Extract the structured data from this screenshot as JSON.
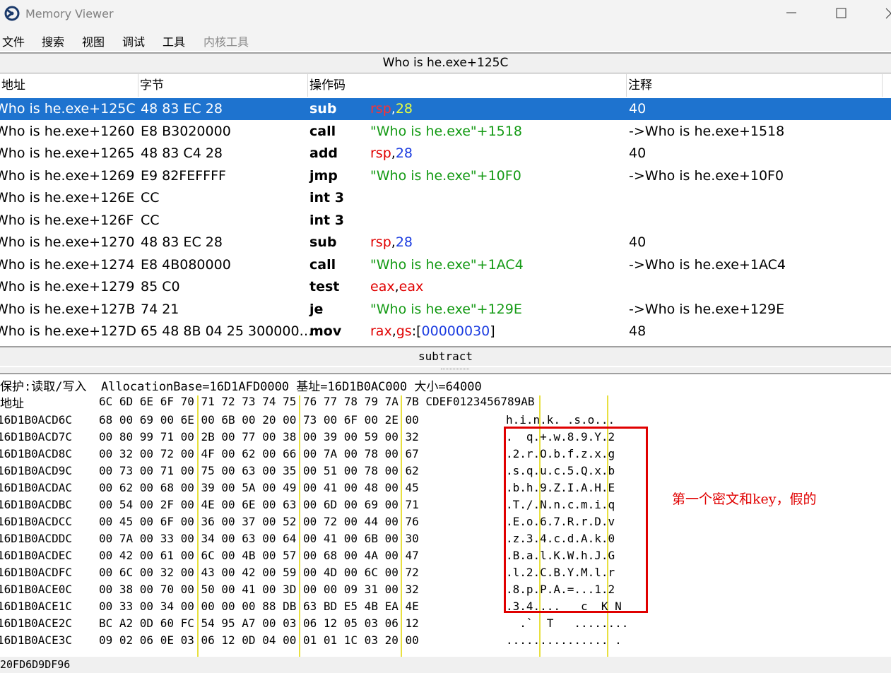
{
  "window": {
    "title": "Memory Viewer",
    "icons": {
      "app": "cheat-engine-icon",
      "minimize": "minimize-icon",
      "maximize": "maximize-icon",
      "close": "close-icon"
    }
  },
  "menu": [
    "文件",
    "搜索",
    "视图",
    "调试",
    "工具",
    "内核工具"
  ],
  "disasm": {
    "header": "Who is he.exe+125C",
    "columns": [
      "地址",
      "字节",
      "操作码",
      "注释"
    ],
    "rows": [
      {
        "addr": "Who is he.exe+125C",
        "bytes": "48 83 EC 28",
        "op": "sub",
        "args": [
          [
            "rsp",
            "red"
          ],
          [
            ",",
            ""
          ],
          [
            "28",
            "blue"
          ]
        ],
        "comment": "40",
        "selected": true
      },
      {
        "addr": "Who is he.exe+1260",
        "bytes": "E8 B3020000",
        "op": "call",
        "args": [
          [
            "\"Who is he.exe\"+1518",
            "green"
          ]
        ],
        "comment": "->Who is he.exe+1518"
      },
      {
        "addr": "Who is he.exe+1265",
        "bytes": "48 83 C4 28",
        "op": "add",
        "args": [
          [
            "rsp",
            "red"
          ],
          [
            ",",
            ""
          ],
          [
            "28",
            "blue"
          ]
        ],
        "comment": "40"
      },
      {
        "addr": "Who is he.exe+1269",
        "bytes": "E9 82FEFFFF",
        "op": "jmp",
        "args": [
          [
            "\"Who is he.exe\"+10F0",
            "green"
          ]
        ],
        "comment": "->Who is he.exe+10F0"
      },
      {
        "addr": "Who is he.exe+126E",
        "bytes": "CC",
        "op": "int 3",
        "args": [],
        "comment": ""
      },
      {
        "addr": "Who is he.exe+126F",
        "bytes": "CC",
        "op": "int 3",
        "args": [],
        "comment": ""
      },
      {
        "addr": "Who is he.exe+1270",
        "bytes": "48 83 EC 28",
        "op": "sub",
        "args": [
          [
            "rsp",
            "red"
          ],
          [
            ",",
            ""
          ],
          [
            "28",
            "blue"
          ]
        ],
        "comment": "40"
      },
      {
        "addr": "Who is he.exe+1274",
        "bytes": "E8 4B080000",
        "op": "call",
        "args": [
          [
            "\"Who is he.exe\"+1AC4",
            "green"
          ]
        ],
        "comment": "->Who is he.exe+1AC4"
      },
      {
        "addr": "Who is he.exe+1279",
        "bytes": "85 C0",
        "op": "test",
        "args": [
          [
            "eax",
            "red"
          ],
          [
            ",",
            ""
          ],
          [
            "eax",
            "red"
          ]
        ],
        "comment": ""
      },
      {
        "addr": "Who is he.exe+127B",
        "bytes": "74 21",
        "op": "je",
        "args": [
          [
            "\"Who is he.exe\"+129E",
            "green"
          ]
        ],
        "comment": "->Who is he.exe+129E"
      },
      {
        "addr": "Who is he.exe+127D",
        "bytes": "65 48 8B 04 25 300000…",
        "op": "mov",
        "args": [
          [
            "rax",
            "red"
          ],
          [
            ",",
            ""
          ],
          [
            "gs",
            "red"
          ],
          [
            ":[",
            ""
          ],
          [
            "00000030",
            "blue"
          ],
          [
            "]",
            ""
          ]
        ],
        "comment": "48"
      }
    ]
  },
  "status": "subtract",
  "hex": {
    "info": "保护:读取/写入  AllocationBase=16D1AFD0000 基址=16D1B0AC000 大小=64000",
    "header_label": "地址",
    "header_cols": "6C 6D 6E 6F 70 71 72 73 74 75 76 77 78 79 7A 7B CDEF0123456789AB",
    "rows": [
      {
        "addr": "16D1B0ACD6C",
        "bytes": "68 00 69 00 6E 00 6B 00 20 00 73 00 6F 00 2E 00",
        "ascii": "h.i.n.k. .s.o..."
      },
      {
        "addr": "16D1B0ACD7C",
        "bytes": "00 80 99 71 00 2B 00 77 00 38 00 39 00 59 00 32",
        "ascii": ".  q.+.w.8.9.Y.2"
      },
      {
        "addr": "16D1B0ACD8C",
        "bytes": "00 32 00 72 00 4F 00 62 00 66 00 7A 00 78 00 67",
        "ascii": ".2.r.O.b.f.z.x.g"
      },
      {
        "addr": "16D1B0ACD9C",
        "bytes": "00 73 00 71 00 75 00 63 00 35 00 51 00 78 00 62",
        "ascii": ".s.q.u.c.5.Q.x.b"
      },
      {
        "addr": "16D1B0ACDAC",
        "bytes": "00 62 00 68 00 39 00 5A 00 49 00 41 00 48 00 45",
        "ascii": ".b.h.9.Z.I.A.H.E"
      },
      {
        "addr": "16D1B0ACDBC",
        "bytes": "00 54 00 2F 00 4E 00 6E 00 63 00 6D 00 69 00 71",
        "ascii": ".T./.N.n.c.m.i.q"
      },
      {
        "addr": "16D1B0ACDCC",
        "bytes": "00 45 00 6F 00 36 00 37 00 52 00 72 00 44 00 76",
        "ascii": ".E.o.6.7.R.r.D.v"
      },
      {
        "addr": "16D1B0ACDDC",
        "bytes": "00 7A 00 33 00 34 00 63 00 64 00 41 00 6B 00 30",
        "ascii": ".z.3.4.c.d.A.k.0"
      },
      {
        "addr": "16D1B0ACDEC",
        "bytes": "00 42 00 61 00 6C 00 4B 00 57 00 68 00 4A 00 47",
        "ascii": ".B.a.l.K.W.h.J.G"
      },
      {
        "addr": "16D1B0ACDFC",
        "bytes": "00 6C 00 32 00 43 00 42 00 59 00 4D 00 6C 00 72",
        "ascii": ".l.2.C.B.Y.M.l.r"
      },
      {
        "addr": "16D1B0ACE0C",
        "bytes": "00 38 00 70 00 50 00 41 00 3D 00 00 09 31 00 32",
        "ascii": ".8.p.P.A.=...1.2"
      },
      {
        "addr": "16D1B0ACE1C",
        "bytes": "00 33 00 34 00 00 00 00 88 DB 63 BD E5 4B EA 4E",
        "ascii": ".3.4....   c  K N"
      },
      {
        "addr": "16D1B0ACE2C",
        "bytes": "BC A2 0D 60 FC 54 95 A7 00 03 06 12 05 03 06 12",
        "ascii": "  .`  T   ........"
      },
      {
        "addr": "16D1B0ACE3C",
        "bytes": "09 02 06 0E 03 06 12 0D 04 00 01 01 1C 03 20 00",
        "ascii": "............... ."
      }
    ],
    "annotation": "第一个密文和key，假的"
  },
  "bottom": "20FD6D9DF96"
}
